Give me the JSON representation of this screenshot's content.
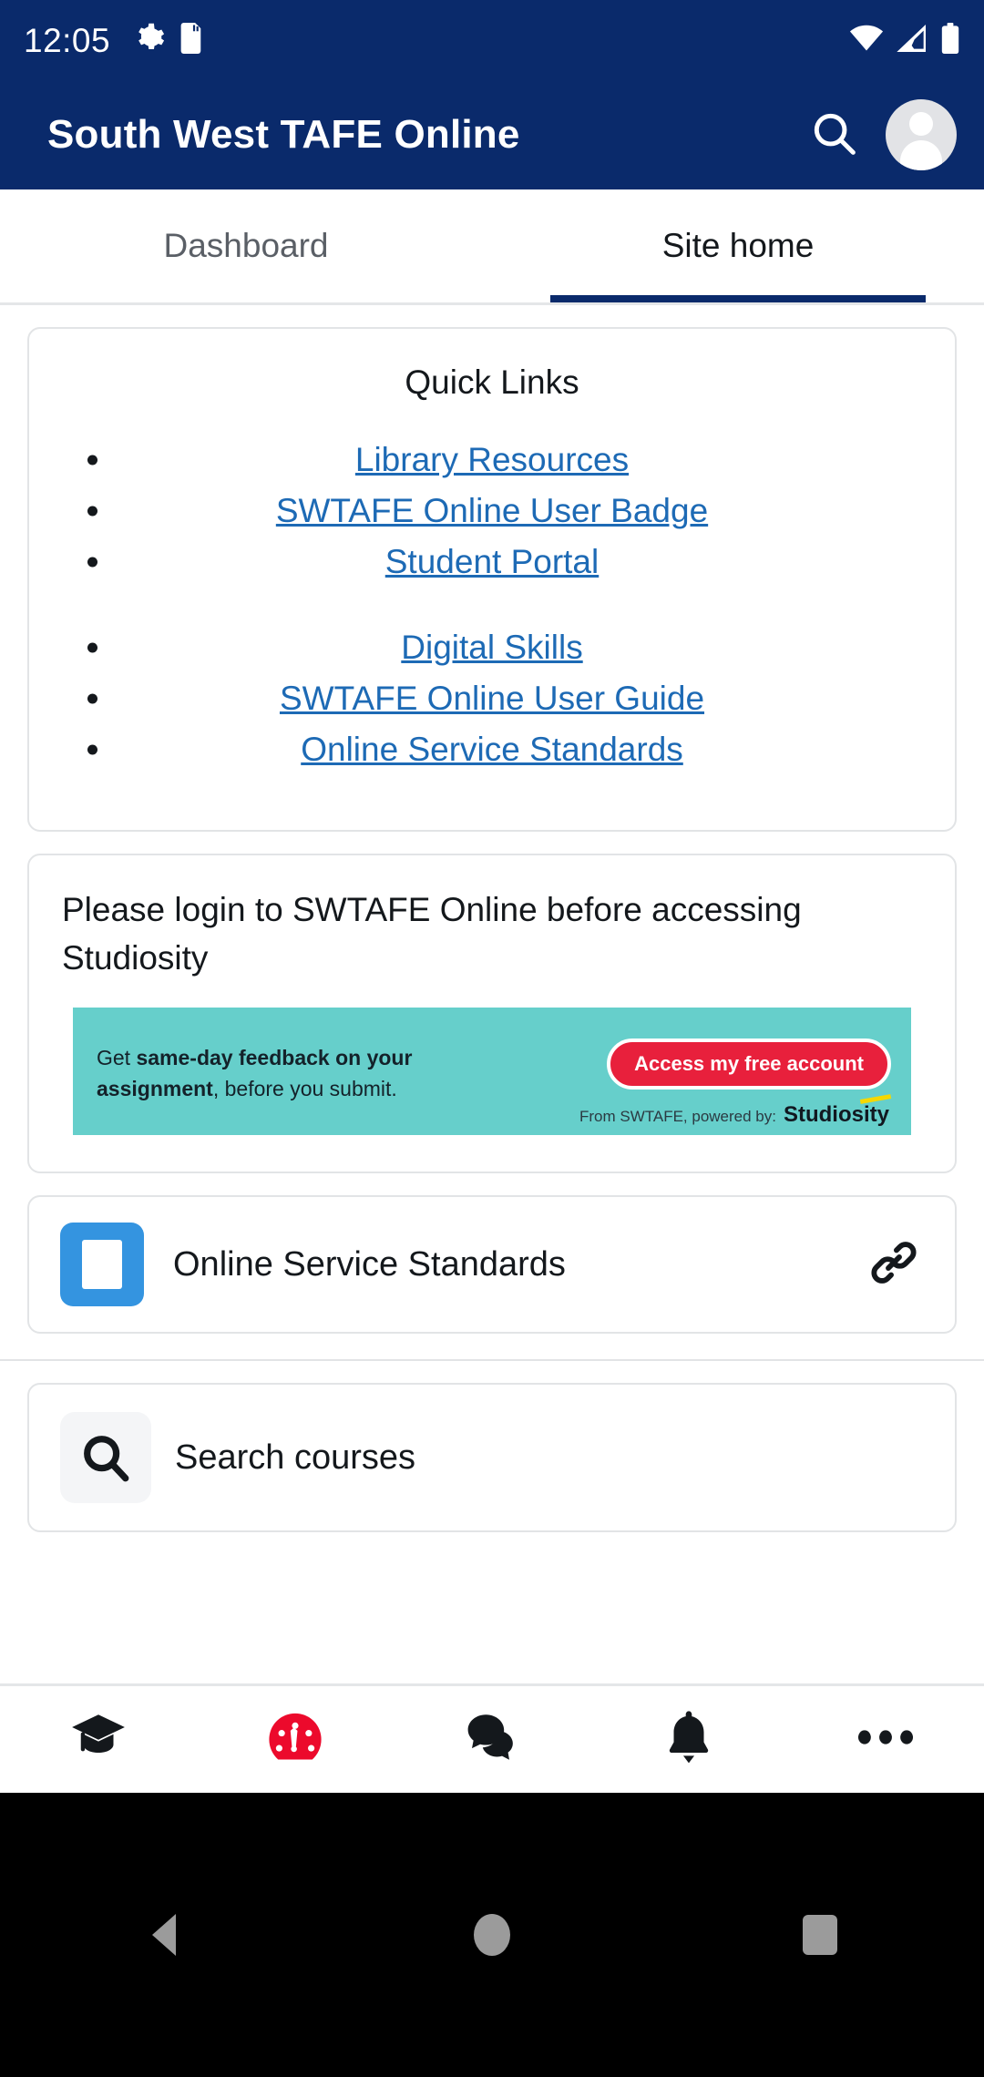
{
  "status_bar": {
    "time": "12:05",
    "left_icons": [
      "settings-gear-icon",
      "sd-card-icon"
    ],
    "right_icons": [
      "wifi-icon",
      "mobile-signal-icon",
      "battery-full-icon"
    ],
    "background_color": "#0a2a6b"
  },
  "app_bar": {
    "title": "South West TAFE Online",
    "search_icon": "search-icon",
    "avatar": "user-avatar",
    "background_color": "#0a2a6b",
    "text_color": "#ffffff"
  },
  "tabs": [
    {
      "label": "Dashboard",
      "active": false
    },
    {
      "label": "Site home",
      "active": true
    }
  ],
  "quick_links_card": {
    "title": "Quick Links",
    "links": [
      {
        "label": "Library Resources",
        "spacer_after": false
      },
      {
        "label": "SWTAFE Online User Badge",
        "spacer_after": false
      },
      {
        "label": "Student Portal",
        "spacer_after": true
      },
      {
        "label": "Digital Skills",
        "spacer_after": false
      },
      {
        "label": "SWTAFE Online User Guide",
        "spacer_after": false
      },
      {
        "label": "Online Service Standards",
        "spacer_after": false
      }
    ],
    "link_color": "#1d6ab5"
  },
  "studiosity_card": {
    "notice": "Please login to SWTAFE Online before accessing Studiosity",
    "banner": {
      "background_color": "#66cfcb",
      "line1_prefix": "Get ",
      "line1_bold": "same-day feedback on your",
      "line2_bold": "assignment",
      "line2_suffix": ", before you submit.",
      "cta_label": "Access my free account",
      "cta_color": "#e8203c",
      "footer_text": "From SWTAFE, powered by:",
      "brand": "Studiosity"
    }
  },
  "module_item": {
    "label": "Online Service Standards",
    "icon": "document-page-icon",
    "icon_color": "#3494e0",
    "action_icon": "link-chain-icon"
  },
  "search_courses": {
    "label": "Search courses",
    "icon": "search-icon"
  },
  "bottom_nav": [
    {
      "name": "graduation-cap-icon",
      "label": "",
      "active": false
    },
    {
      "name": "dashboard-gauge-icon",
      "label": "",
      "active": true
    },
    {
      "name": "chat-bubbles-icon",
      "label": "",
      "active": false
    },
    {
      "name": "notification-bell-icon",
      "label": "",
      "active": false
    },
    {
      "name": "more-dots-icon",
      "label": "",
      "active": false
    }
  ],
  "bottom_nav_active_color": "#ec0a2c",
  "android_nav": [
    {
      "name": "back-button"
    },
    {
      "name": "home-button"
    },
    {
      "name": "recents-button"
    }
  ]
}
